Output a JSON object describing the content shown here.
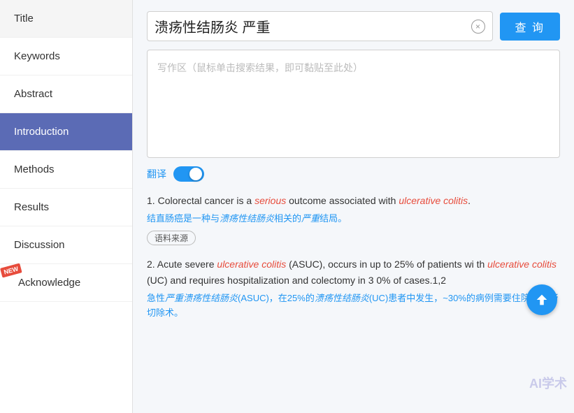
{
  "sidebar": {
    "items": [
      {
        "id": "title",
        "label": "Title",
        "active": false
      },
      {
        "id": "keywords",
        "label": "Keywords",
        "active": false
      },
      {
        "id": "abstract",
        "label": "Abstract",
        "active": false
      },
      {
        "id": "introduction",
        "label": "Introduction",
        "active": true
      },
      {
        "id": "methods",
        "label": "Methods",
        "active": false
      },
      {
        "id": "results",
        "label": "Results",
        "active": false
      },
      {
        "id": "discussion",
        "label": "Discussion",
        "active": false
      },
      {
        "id": "acknowledge",
        "label": "Acknowledge",
        "active": false,
        "badge": "NEW"
      }
    ]
  },
  "search": {
    "query": "溃疡性结肠炎 严重",
    "clear_label": "×",
    "query_button_label": "查 询",
    "writing_placeholder": "写作区（鼠标单击搜索结果，即可黏贴至此处）"
  },
  "translate": {
    "label": "翻译",
    "enabled": true
  },
  "results": [
    {
      "num": "1.",
      "en_parts": [
        {
          "text": "Colorectal cancer is a ",
          "style": "normal"
        },
        {
          "text": "serious",
          "style": "italic-red"
        },
        {
          "text": " outcome associated with ",
          "style": "normal"
        },
        {
          "text": "ulcerative colitis",
          "style": "italic-red"
        },
        {
          "text": ".",
          "style": "normal"
        }
      ],
      "cn_parts": [
        {
          "text": "结直肠癌是一种与",
          "style": "normal"
        },
        {
          "text": "溃疡性结肠炎",
          "style": "italic-blue"
        },
        {
          "text": "相关的",
          "style": "normal"
        },
        {
          "text": "严重",
          "style": "italic-blue"
        },
        {
          "text": "结局。",
          "style": "normal"
        }
      ],
      "source_tag": "语料来源"
    },
    {
      "num": "2.",
      "en_parts": [
        {
          "text": "Acute severe ",
          "style": "normal"
        },
        {
          "text": "ulcerative colitis",
          "style": "italic-red"
        },
        {
          "text": " (ASUC), occurs in up to 25% of patients wi th ",
          "style": "normal"
        },
        {
          "text": "ulcerative colitis",
          "style": "italic-red"
        },
        {
          "text": " (UC) and requires hospitalization and colectomy in 3 0% of cases.1,2",
          "style": "normal"
        }
      ],
      "cn_parts": [
        {
          "text": "急性",
          "style": "normal"
        },
        {
          "text": "严重溃疡性结肠炎",
          "style": "italic-blue"
        },
        {
          "text": "(ASUC)，在25%的",
          "style": "normal"
        },
        {
          "text": "溃疡性结肠炎",
          "style": "italic-blue"
        },
        {
          "text": "(UC)患者中发生，~30%的病例需要住院和",
          "style": "normal"
        },
        {
          "text": "结肠",
          "style": "italic-blue"
        },
        {
          "text": "切除术。",
          "style": "normal"
        }
      ],
      "source_tag": null
    }
  ],
  "watermark": "AI学术"
}
